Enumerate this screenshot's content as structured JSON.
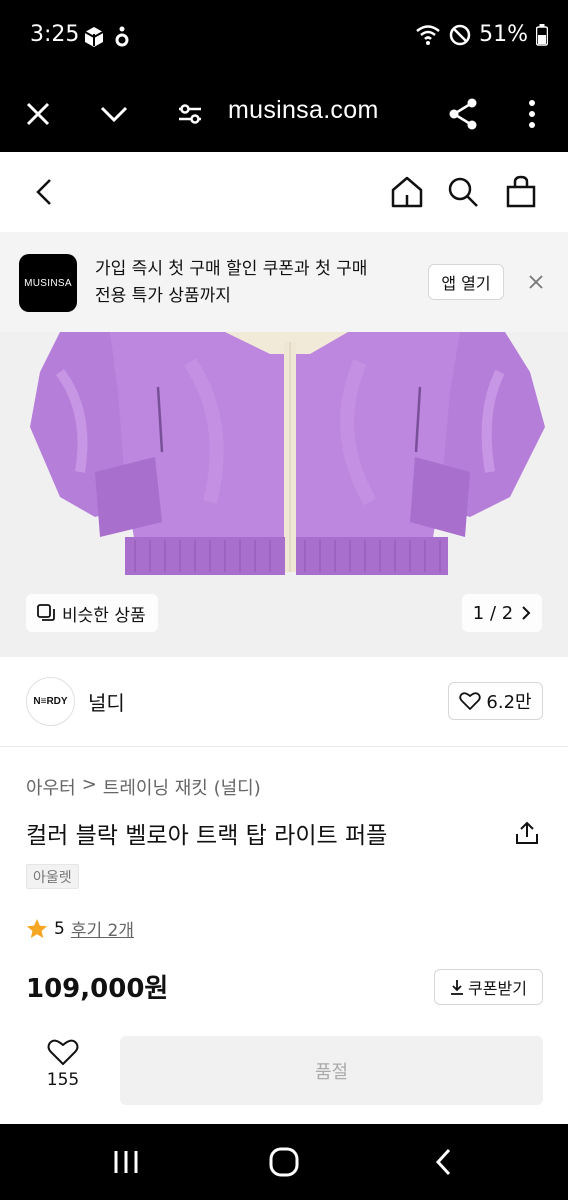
{
  "status_bar": {
    "time": "3:25",
    "battery": "51%"
  },
  "browser": {
    "url": "musinsa.com"
  },
  "app_banner": {
    "logo_text": "MUSINSA",
    "message_line1": "가입 즉시 첫 구매 할인 쿠폰과 첫 구매",
    "message_line2": "전용 특가 상품까지",
    "open_app_label": "앱 열기"
  },
  "gallery": {
    "similar_label": "비슷한 상품",
    "pager": "1 / 2"
  },
  "brand": {
    "logo_text": "N≡RDY",
    "name": "널디",
    "likes": "6.2만"
  },
  "product": {
    "breadcrumb": [
      "아우터",
      "트레이닝 재킷 (널디)"
    ],
    "title": "컬러 블락 벨로아 트랙 탑 라이트 퍼플",
    "tag": "아울렛",
    "rating": "5",
    "reviews": "후기 2개",
    "price": "109,000원",
    "coupon_label": "쿠폰받기"
  },
  "bottom": {
    "wish_count": "155",
    "soldout_label": "품절"
  },
  "colors": {
    "accent_star": "#f5a623",
    "jacket_purple": "#b57ed8",
    "dark_bar": "#000000"
  }
}
